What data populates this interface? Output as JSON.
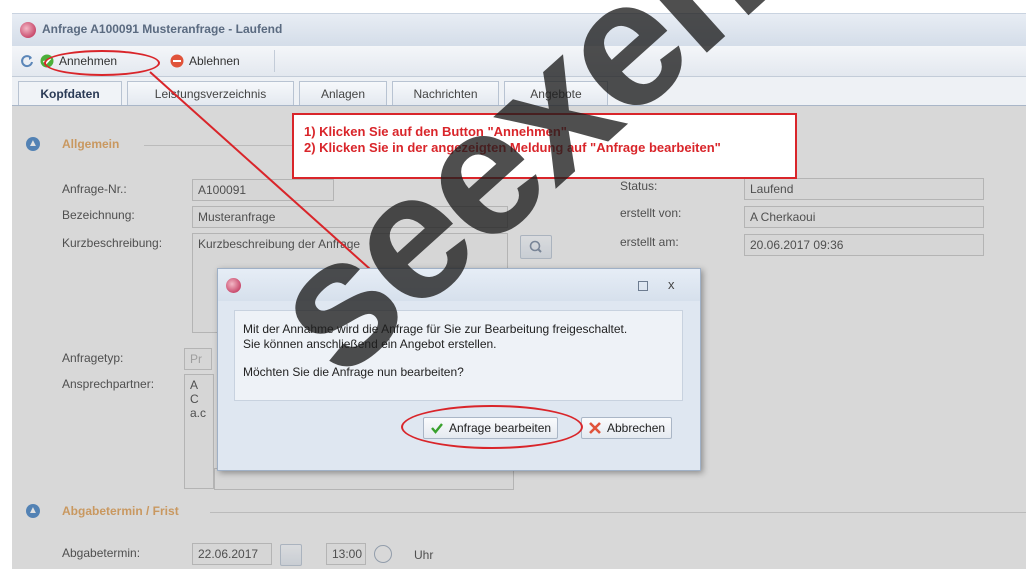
{
  "window": {
    "title": "Anfrage A100091 Musteranfrage - Laufend"
  },
  "toolbar": {
    "accept_label": "Annehmen",
    "reject_label": "Ablehnen"
  },
  "tabs": [
    {
      "label": "Kopfdaten"
    },
    {
      "label": "Leistungsverzeichnis"
    },
    {
      "label": "Anlagen"
    },
    {
      "label": "Nachrichten"
    },
    {
      "label": "Angebote"
    }
  ],
  "section_general": {
    "title": "Allgemein"
  },
  "form": {
    "request_no": {
      "label": "Anfrage-Nr.:",
      "value": "A100091"
    },
    "designation": {
      "label": "Bezeichnung:",
      "value": "Musteranfrage"
    },
    "short_desc": {
      "label": "Kurzbeschreibung:",
      "value": "Kurzbeschreibung der Anfrage"
    },
    "status": {
      "label": "Status:",
      "value": "Laufend"
    },
    "created_by": {
      "label": "erstellt von:",
      "value": "A Cherkaoui"
    },
    "created_at": {
      "label": "erstellt am:",
      "value": "20.06.2017 09:36"
    },
    "request_type": {
      "label": "Anfragetyp:",
      "value": "Pr"
    },
    "contact": {
      "label": "Ansprechpartner:",
      "value_line1": "A C",
      "value_line2": "a.c"
    }
  },
  "section_deadline": {
    "title": "Abgabetermin / Frist"
  },
  "deadline": {
    "label": "Abgabetermin:",
    "date": "22.06.2017",
    "time": "13:00",
    "unit": "Uhr"
  },
  "instruction": {
    "line1": "1) Klicken Sie auf den Button \"Annehmen\"",
    "line2": "2) Klicken Sie in der angezeigten Meldung auf \"Anfrage bearbeiten\""
  },
  "dialog": {
    "close_glyph": "x",
    "message_line1": "Mit der Annahme wird die Anfrage für Sie zur Bearbeitung freigeschaltet.",
    "message_line2": "Sie können anschließend ein Angebot erstellen.",
    "question": "Möchten Sie die Anfrage nun bearbeiten?",
    "confirm_label": "Anfrage bearbeiten",
    "cancel_label": "Abbrechen"
  },
  "watermark": {
    "text": "seexemplar"
  },
  "colors": {
    "annotation_red": "#d9252a",
    "section_title": "#e0a25a",
    "section_icon": "#4a86c6"
  }
}
